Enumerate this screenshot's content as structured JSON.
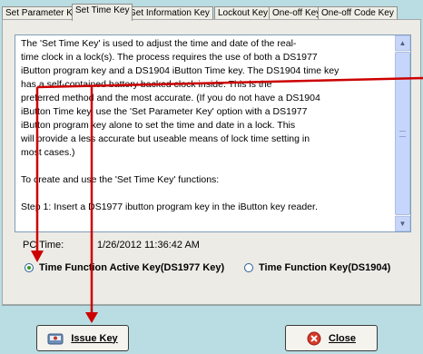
{
  "tabs": [
    {
      "label": "Set Parameter Key",
      "active": false
    },
    {
      "label": "Set Time Key",
      "active": true
    },
    {
      "label": "Get Information Key",
      "active": false
    },
    {
      "label": "Lockout Key",
      "active": false
    },
    {
      "label": "One-off Key",
      "active": false
    },
    {
      "label": "One-off Code Key",
      "active": false
    }
  ],
  "instructions": {
    "text": "The 'Set Time Key' is used to adjust the time and date of the real-\ntime clock in a lock(s). The process requires the use of both a DS1977\niButton program key and a DS1904 iButton Time key. The DS1904 time key\nhas a self-contained battery backed clock inside. This is the\npreferred method and the most accurate. (If you do not have a DS1904\niButton Time key, use the 'Set Parameter Key' option with a DS1977\niButton program key alone to set the time and date in a lock. This\nwill provide a less accurate but useable means of lock time setting in\nmost cases.)\n\nTo create and use the 'Set Time Key' functions:\n\nStep 1: Insert a DS1977 ibutton program key in the iButton key reader."
  },
  "pc_time": {
    "label": "PC Time:",
    "value": "1/26/2012 11:36:42 AM"
  },
  "options": [
    {
      "label": "Time Function Active Key(DS1977 Key)",
      "selected": true
    },
    {
      "label": "Time Function Key(DS1904)",
      "selected": false
    }
  ],
  "buttons": {
    "issue": "Issue Key",
    "close": "Close"
  },
  "colors": {
    "annotation_arrow": "#cc0000",
    "background": "#b9dde2"
  },
  "icons": {
    "issue": "key-reader-icon",
    "close": "red-x-close-icon"
  }
}
